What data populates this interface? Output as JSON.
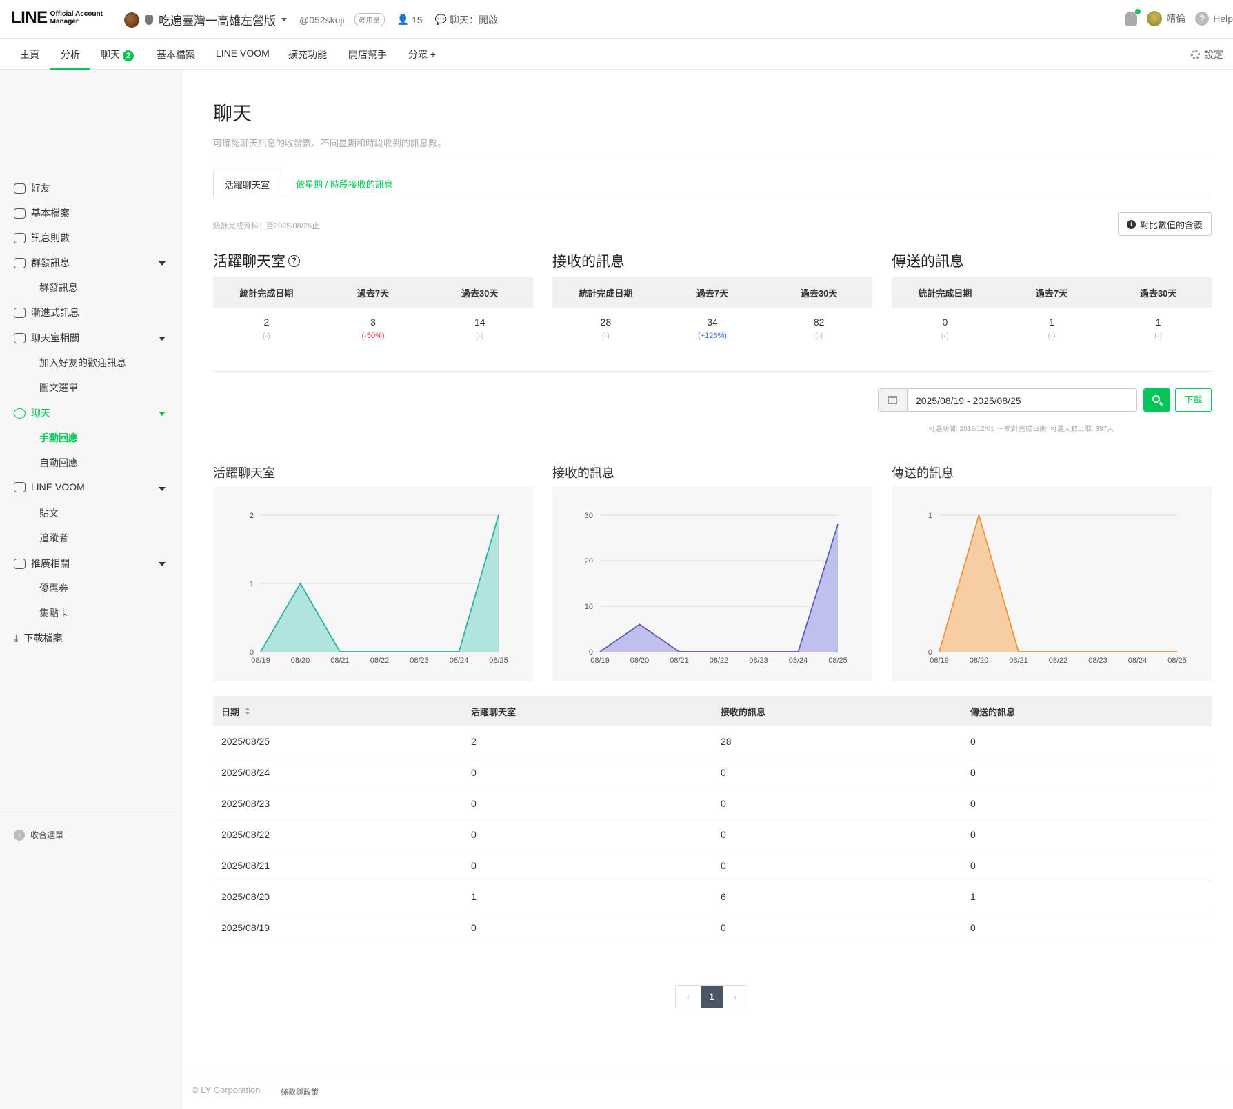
{
  "header": {
    "logo_main": "LINE",
    "logo_sub1": "Official Account",
    "logo_sub2": "Manager",
    "account_name": "吃遍臺灣一高雄左營版",
    "account_id": "@052skuji",
    "plan_badge": "輕用量",
    "friends_count": "15",
    "chat_status": "聊天：開啟",
    "user_name": "靖倫",
    "help": "Help"
  },
  "nav": {
    "items": [
      "主頁",
      "分析",
      "聊天",
      "基本檔案",
      "LINE VOOM",
      "擴充功能",
      "開店幫手",
      "分眾 +"
    ],
    "chat_badge": "2",
    "settings": "設定"
  },
  "sidebar": {
    "items": [
      "好友",
      "基本檔案",
      "訊息則數",
      "群發訊息",
      "群發訊息",
      "漸進式訊息",
      "聊天室相關",
      "加入好友的歡迎訊息",
      "圖文選單",
      "聊天",
      "手動回應",
      "自動回應",
      "LINE VOOM",
      "貼文",
      "追蹤者",
      "推廣相關",
      "優惠券",
      "集點卡",
      "下載檔案"
    ],
    "collapse": "收合選單"
  },
  "page": {
    "title": "聊天",
    "description": "可確認聊天訊息的收發數、不同星期和時段收到的訊息數。",
    "tab_active": "活躍聊天室",
    "tab_link": "依星期 / 時段接收的訊息",
    "stat_note": "統計完成資料：至2025/08/25止",
    "compare_btn": "對比數值的含義"
  },
  "summary": {
    "columns": [
      "統計完成日期",
      "過去7天",
      "過去30天"
    ],
    "blocks": [
      {
        "title": "活躍聊天室",
        "values": [
          "2",
          "3",
          "14"
        ],
        "diffs": [
          "(-)",
          "(-50%)",
          "(-)"
        ]
      },
      {
        "title": "接收的訊息",
        "values": [
          "28",
          "34",
          "82"
        ],
        "diffs": [
          "(-)",
          "(+126%)",
          "(-)"
        ]
      },
      {
        "title": "傳送的訊息",
        "values": [
          "0",
          "1",
          "1"
        ],
        "diffs": [
          "(-)",
          "(-)",
          "(-)"
        ]
      }
    ]
  },
  "date_filter": {
    "range": "2025/08/19 - 2025/08/25",
    "download": "下載",
    "note": "可選期間: 2018/12/01 ～ 統計完成日期, 可選天數上限: 397天"
  },
  "chart_data": [
    {
      "type": "area",
      "title": "活躍聊天室",
      "x": [
        "08/19",
        "08/20",
        "08/21",
        "08/22",
        "08/23",
        "08/24",
        "08/25"
      ],
      "values": [
        0,
        1,
        0,
        0,
        0,
        0,
        2
      ],
      "ylim": [
        0,
        2
      ],
      "yticks": [
        0,
        1,
        2
      ],
      "color": "#27b3a8",
      "fill": "#b1e3df"
    },
    {
      "type": "area",
      "title": "接收的訊息",
      "x": [
        "08/19",
        "08/20",
        "08/21",
        "08/22",
        "08/23",
        "08/24",
        "08/25"
      ],
      "values": [
        0,
        6,
        0,
        0,
        0,
        0,
        28
      ],
      "ylim": [
        0,
        30
      ],
      "yticks": [
        0,
        10,
        20,
        30
      ],
      "color": "#5b5bc0",
      "fill": "#bfc0ec"
    },
    {
      "type": "area",
      "title": "傳送的訊息",
      "x": [
        "08/19",
        "08/20",
        "08/21",
        "08/22",
        "08/23",
        "08/24",
        "08/25"
      ],
      "values": [
        0,
        1,
        0,
        0,
        0,
        0,
        0
      ],
      "ylim": [
        0,
        1
      ],
      "yticks": [
        0,
        1
      ],
      "color": "#f0943a",
      "fill": "#f7cda4"
    }
  ],
  "table": {
    "headers": [
      "日期",
      "活躍聊天室",
      "接收的訊息",
      "傳送的訊息"
    ],
    "rows": [
      [
        "2025/08/25",
        "2",
        "28",
        "0"
      ],
      [
        "2025/08/24",
        "0",
        "0",
        "0"
      ],
      [
        "2025/08/23",
        "0",
        "0",
        "0"
      ],
      [
        "2025/08/22",
        "0",
        "0",
        "0"
      ],
      [
        "2025/08/21",
        "0",
        "0",
        "0"
      ],
      [
        "2025/08/20",
        "1",
        "6",
        "1"
      ],
      [
        "2025/08/19",
        "0",
        "0",
        "0"
      ]
    ]
  },
  "pagination": {
    "current": "1",
    "prev": "‹",
    "next": "›"
  },
  "footer": {
    "copyright": "© LY Corporation",
    "terms": "條款與政策"
  }
}
